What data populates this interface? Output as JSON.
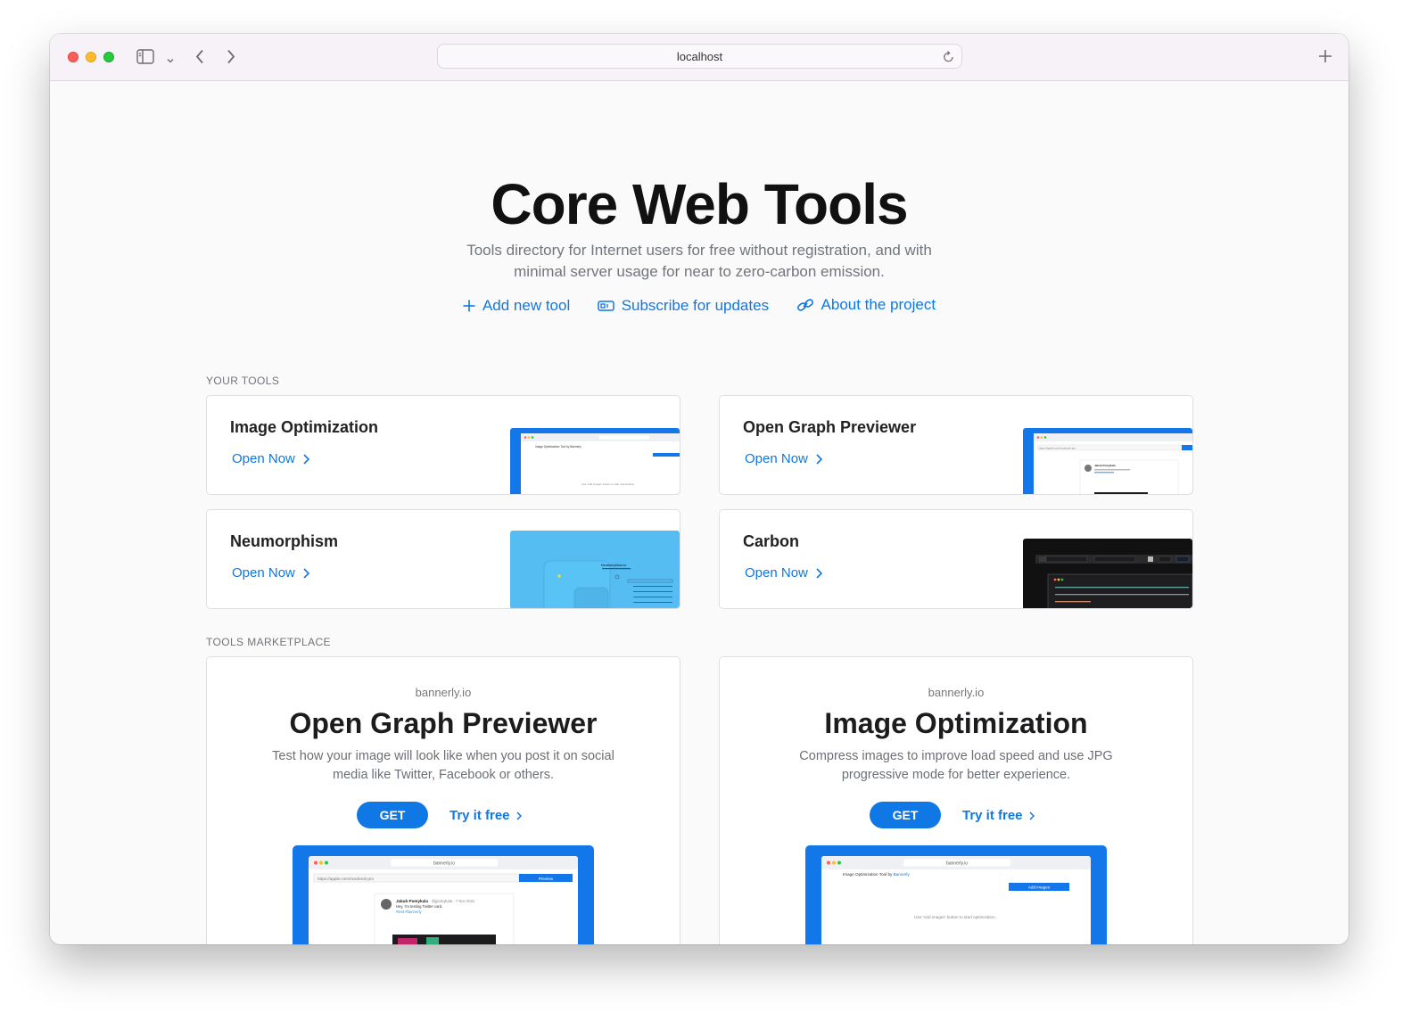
{
  "browser": {
    "address": "localhost"
  },
  "hero": {
    "title": "Core Web Tools",
    "subtitle": "Tools directory for Internet users for free without registration, and with minimal server usage for near to zero-carbon emission.",
    "links": [
      {
        "label": "Add new tool",
        "icon": "plus-icon"
      },
      {
        "label": "Subscribe for updates",
        "icon": "mailbox-icon"
      },
      {
        "label": "About the project",
        "icon": "link-icon"
      }
    ]
  },
  "your_tools": {
    "label": "YOUR TOOLS",
    "open_label": "Open Now",
    "items": [
      {
        "name": "Image Optimization",
        "thumb_text_1": "Image Optimization Tool by Bannerly",
        "thumb_text_2": "Use 'Add images' button to start optimization."
      },
      {
        "name": "Open Graph Previewer",
        "thumb_text_1": "https://apple.com/macbook-pro",
        "thumb_text_2": "Jakub Pomykala"
      },
      {
        "name": "Neumorphism",
        "thumb_text_1": "Neumorphism.io"
      },
      {
        "name": "Carbon"
      }
    ]
  },
  "marketplace": {
    "label": "TOOLS MARKETPLACE",
    "get_label": "GET",
    "try_label": "Try it free",
    "items": [
      {
        "vendor": "bannerly.io",
        "title": "Open Graph Previewer",
        "description": "Test how your image will look like when you post it on social media like Twitter, Facebook or others.",
        "shot": {
          "address": "bannerly.io",
          "url_input": "https://apple.com/macbook-pro",
          "button": "Preview",
          "tweet_author": "Jakub Pomykala",
          "tweet_handle": "@jpomykala · 7 Nov 2021",
          "tweet_text": "Hey, I'm testing Twitter card.",
          "tweet_tags": "#test #bannerly"
        }
      },
      {
        "vendor": "bannerly.io",
        "title": "Image Optimization",
        "description": "Compress images to improve load speed and use JPG progressive mode for better experience.",
        "shot": {
          "address": "bannerly.io",
          "heading_prefix": "Image Optimization Tool by ",
          "heading_brand": "Bannerly",
          "button": "Add images",
          "hint": "Use 'Add images' button to start optimization."
        }
      }
    ]
  },
  "colors": {
    "accent": "#0f78e4",
    "neumorphism": "#55bdf2",
    "carbon": "#111111"
  }
}
